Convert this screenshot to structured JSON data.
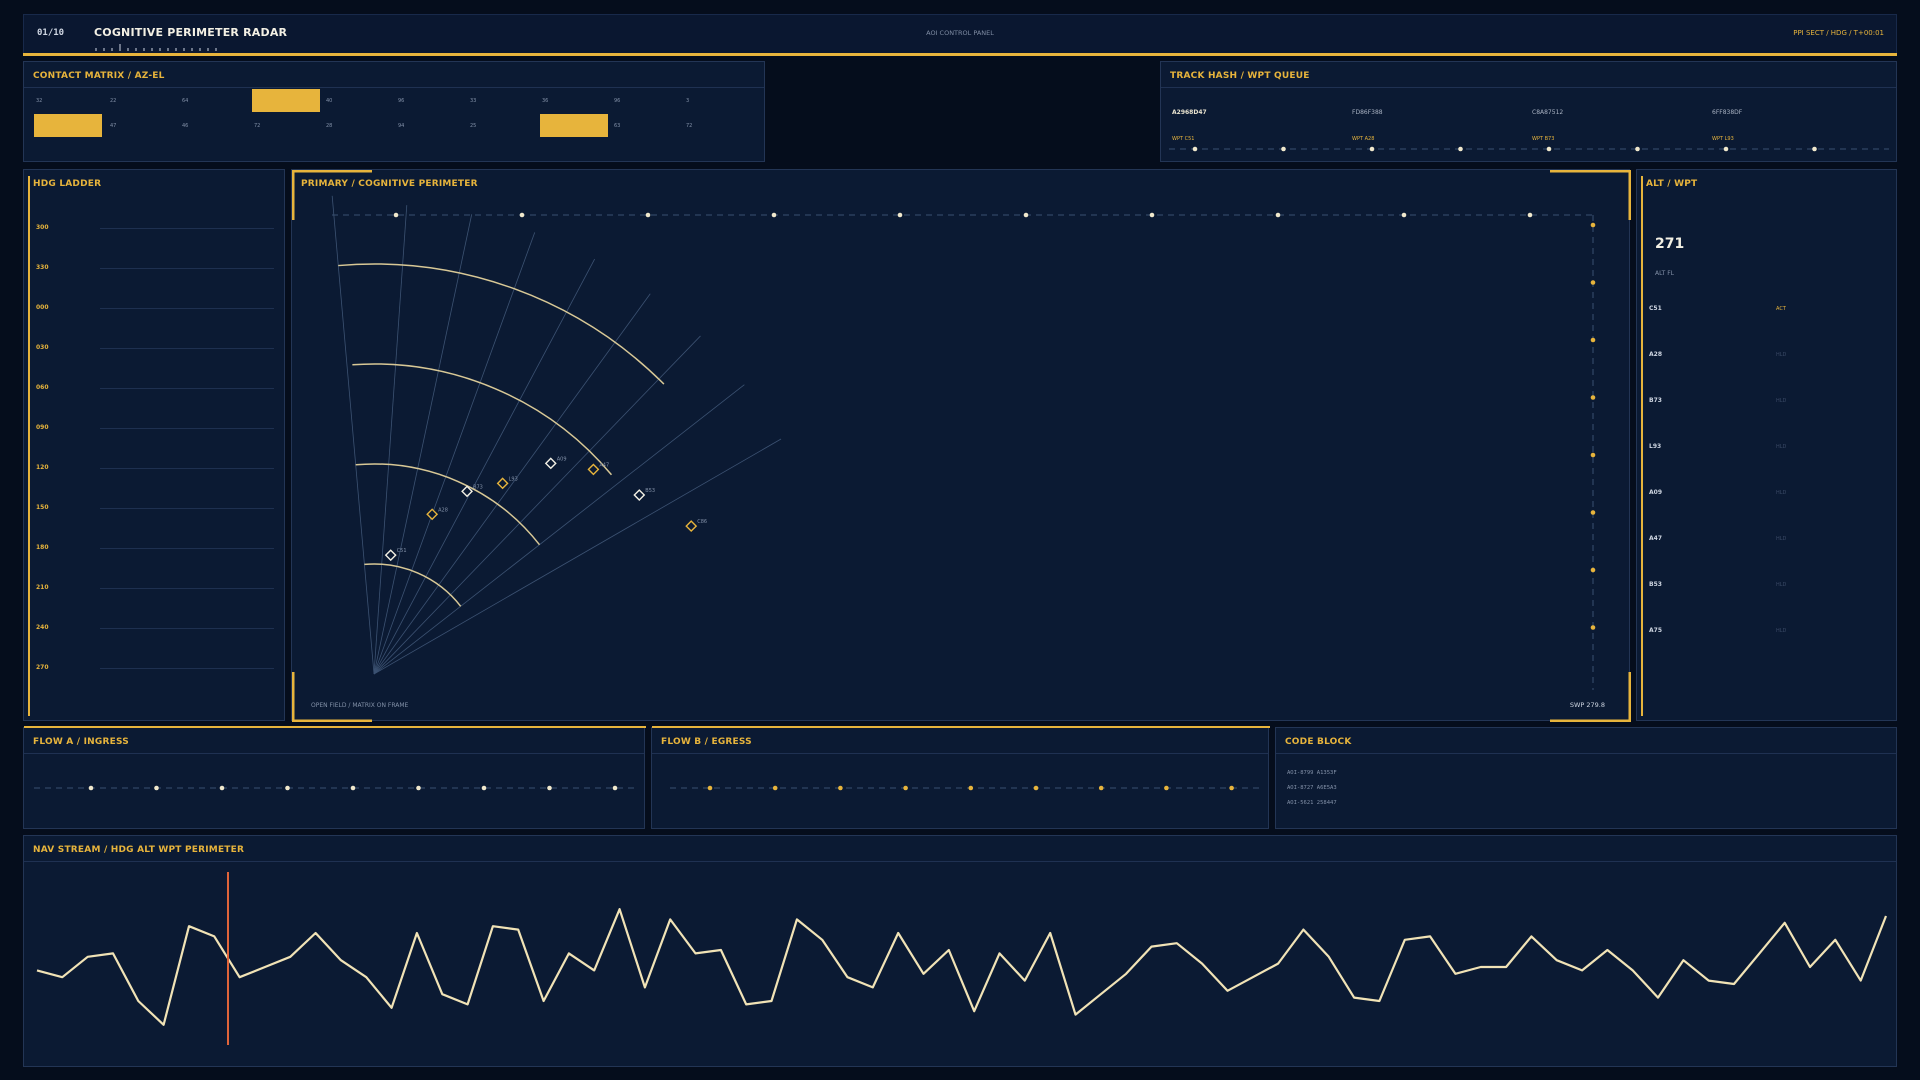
{
  "header": {
    "page_counter": "01/10",
    "title": "COGNITIVE PERIMETER RADAR",
    "center_label": "AOI CONTROL PANEL",
    "status": "PPI SECT / HDG / T+00:01"
  },
  "contact_matrix": {
    "title": "CONTACT MATRIX / AZ-EL",
    "rows": [
      [
        "32",
        "22",
        "64",
        "",
        "40",
        "96",
        "33",
        "36",
        "96",
        "3"
      ],
      [
        "",
        "47",
        "46",
        "72",
        "28",
        "94",
        "25",
        "",
        "63",
        "72"
      ]
    ],
    "highlighted": [
      [
        0,
        3
      ],
      [
        1,
        0
      ],
      [
        1,
        7
      ]
    ]
  },
  "track_hash": {
    "title": "TRACK HASH / WPT QUEUE",
    "hashes": [
      "A2968D47",
      "FD86F388",
      "C8A87512",
      "6FF838DF"
    ],
    "waypoints": [
      "WPT C51",
      "WPT A28",
      "WPT B73",
      "WPT L93"
    ]
  },
  "hdg_ladder": {
    "title": "HDG LADDER",
    "ticks": [
      "300",
      "330",
      "000",
      "030",
      "060",
      "090",
      "120",
      "150",
      "180",
      "210",
      "240",
      "270"
    ]
  },
  "primary": {
    "title": "PRIMARY / COGNITIVE PERIMETER",
    "footer_left": "OPEN FIELD / MATRIX ON FRAME",
    "footer_right": "SWP 279.8",
    "contacts": [
      {
        "label": "C51"
      },
      {
        "label": "A28"
      },
      {
        "label": "B73"
      },
      {
        "label": "L93"
      },
      {
        "label": "A09"
      },
      {
        "label": "A47"
      },
      {
        "label": "B53"
      },
      {
        "label": "C86"
      }
    ]
  },
  "alt_wpt": {
    "title": "ALT / WPT",
    "value": "271",
    "unit": "ALT FL",
    "rows": [
      {
        "id": "C51",
        "status": "ACT"
      },
      {
        "id": "A28",
        "status": "HLD"
      },
      {
        "id": "B73",
        "status": "HLD"
      },
      {
        "id": "L93",
        "status": "HLD"
      },
      {
        "id": "A09",
        "status": "HLD"
      },
      {
        "id": "A47",
        "status": "HLD"
      },
      {
        "id": "B53",
        "status": "HLD"
      },
      {
        "id": "A75",
        "status": "HLD"
      }
    ]
  },
  "flow_a": {
    "title": "FLOW A / INGRESS"
  },
  "flow_b": {
    "title": "FLOW B / EGRESS"
  },
  "code_block": {
    "title": "CODE BLOCK",
    "lines": [
      "AOI-8799 A1353F",
      "AOI-8727 A6E5A3",
      "AOI-5621 258447"
    ]
  },
  "nav_stream": {
    "title": "NAV STREAM / HDG ALT WPT PERIMETER",
    "series": [
      54,
      52,
      58,
      59,
      45,
      38,
      67,
      64,
      52,
      55,
      58,
      65,
      57,
      52,
      43,
      65,
      47,
      44,
      67,
      66,
      45,
      59,
      54,
      72,
      49,
      69,
      59,
      60,
      44,
      45,
      69,
      63,
      52,
      49,
      65,
      53,
      60,
      42,
      59,
      51,
      65,
      41,
      47,
      53,
      61,
      62,
      56,
      48,
      52,
      56,
      66,
      58,
      46,
      45,
      63,
      64,
      53,
      55,
      55,
      64,
      57,
      54,
      60,
      54,
      46,
      57,
      51,
      50,
      59,
      68,
      55,
      63,
      51,
      70
    ]
  },
  "colors": {
    "accent": "#e7b43c",
    "background": "#050d1c",
    "panel": "#0b1a33",
    "trace": "#f1e3b6",
    "marker": "#e0643a"
  }
}
